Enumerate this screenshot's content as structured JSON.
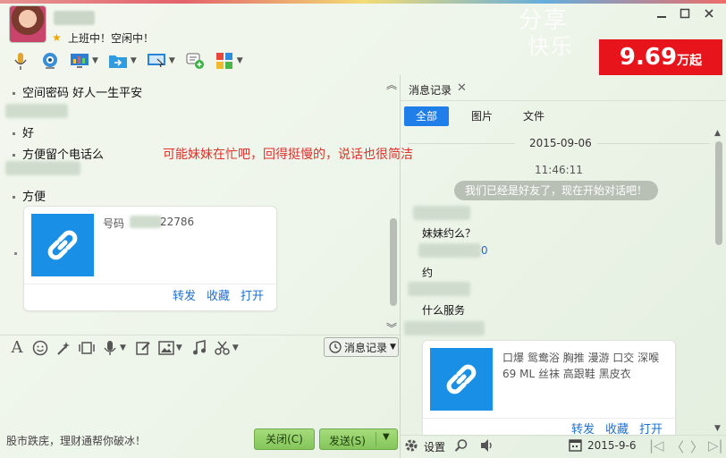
{
  "header": {
    "status_text": "上班中！空闲中！",
    "watermark_line1": "分享",
    "watermark_line2": "快乐",
    "window_controls": [
      "minimize-icon",
      "maximize-icon",
      "close-icon"
    ],
    "ad": {
      "amount": "9.69",
      "unit": "万起"
    }
  },
  "toolbar": {
    "icons": [
      "microphone-icon",
      "video-call-icon",
      "screen-share-icon",
      "file-transfer-icon",
      "remote-desktop-icon",
      "invite-chat-icon",
      "apps-grid-icon"
    ]
  },
  "chat": {
    "messages": [
      {
        "text": "空间密码 好人一生平安"
      },
      {
        "text": "好"
      },
      {
        "text": "方便留个电话么"
      },
      {
        "text": "方便"
      }
    ],
    "annotation": "可能妹妹在忙吧，回得挺慢的，说话也很简洁",
    "card": {
      "prefix": "号码",
      "suffix": "22786",
      "actions": [
        "转发",
        "收藏",
        "打开"
      ]
    }
  },
  "input_toolbar": {
    "icons": [
      "font-icon",
      "emoji-icon",
      "magic-wand-icon",
      "video-clip-icon",
      "voice-icon",
      "edit-icon",
      "image-icon",
      "music-icon",
      "scissors-icon"
    ],
    "history_label": "消息记录"
  },
  "footer": {
    "hint": "股市跌庑，理财通帮你破冰！",
    "close_label": "关闭(C)",
    "send_label": "发送(S)"
  },
  "history": {
    "tab_title": "消息记录",
    "filters": [
      "全部",
      "图片",
      "文件"
    ],
    "date": "2015-09-06",
    "time": "11:46:11",
    "system_message": "我们已经是好友了，现在开始对话吧！",
    "messages": [
      {
        "text": "妹妹约么？"
      },
      {
        "text": "约"
      },
      {
        "text": "什么服务"
      }
    ],
    "link_fragment": "0",
    "card": {
      "line1": "口爆 鸳鸯浴 胸推 漫游 口交 深喉",
      "line2": "69 ML 丝袜 高跟鞋 黑皮衣",
      "actions": [
        "转发",
        "收藏",
        "打开"
      ]
    },
    "settings_label": "设置",
    "date_picker": "2015-9-6"
  },
  "colors": {
    "primary_blue": "#1f7ee8",
    "link_blue": "#1f6fcf",
    "ad_red": "#e8141c",
    "send_green": "#84c55a",
    "annotation_red": "#e0302a"
  }
}
